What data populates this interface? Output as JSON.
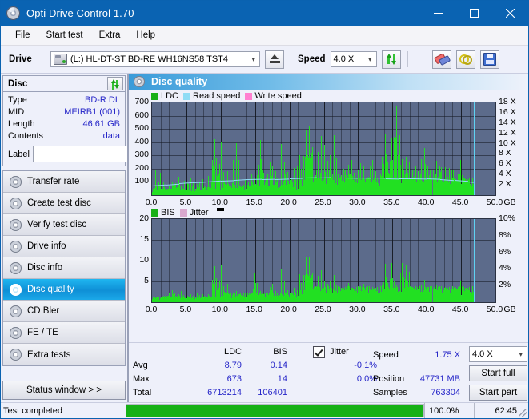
{
  "window": {
    "title": "Opti Drive Control 1.70",
    "icon": "disc-icon",
    "buttons": {
      "minimize": "–",
      "maximize": "□",
      "close": "✕"
    }
  },
  "menu": {
    "items": [
      "File",
      "Start test",
      "Extra",
      "Help"
    ]
  },
  "toolbar": {
    "drive_label": "Drive",
    "drive_value": "(L:)  HL-DT-ST BD-RE  WH16NS58 TST4",
    "eject_icon": "eject-icon",
    "speed_label": "Speed",
    "speed_value": "4.0 X",
    "refresh_icon": "refresh-icon",
    "eraser_icon": "eraser-icon",
    "chain_icon": "chain-icon",
    "save_icon": "floppy-save-icon"
  },
  "disc_panel": {
    "title": "Disc",
    "refresh_icon": "refresh-icon",
    "rows": [
      {
        "key": "Type",
        "value": "BD-R DL"
      },
      {
        "key": "MID",
        "value": "MEIRB1 (001)"
      },
      {
        "key": "Length",
        "value": "46.61 GB"
      },
      {
        "key": "Contents",
        "value": "data"
      }
    ],
    "label_key": "Label",
    "label_value": "",
    "label_placeholder": "",
    "label_button_icon": "cd-disc-icon"
  },
  "sidebar": {
    "items": [
      {
        "label": "Transfer rate",
        "icon": "disc-icon",
        "active": false
      },
      {
        "label": "Create test disc",
        "icon": "disc-icon",
        "active": false
      },
      {
        "label": "Verify test disc",
        "icon": "disc-icon",
        "active": false
      },
      {
        "label": "Drive info",
        "icon": "disc-icon",
        "active": false
      },
      {
        "label": "Disc info",
        "icon": "disc-icon",
        "active": false
      },
      {
        "label": "Disc quality",
        "icon": "disc-icon",
        "active": true
      },
      {
        "label": "CD Bler",
        "icon": "disc-icon",
        "active": false
      },
      {
        "label": "FE / TE",
        "icon": "disc-icon",
        "active": false
      },
      {
        "label": "Extra tests",
        "icon": "disc-icon",
        "active": false
      }
    ],
    "status_window_button": "Status window > >"
  },
  "content": {
    "header_title": "Disc quality",
    "header_icon": "disc-icon"
  },
  "stats": {
    "col_ldc": "LDC",
    "col_bis": "BIS",
    "row_avg": "Avg",
    "row_max": "Max",
    "row_total": "Total",
    "ldc_avg": "8.79",
    "ldc_max": "673",
    "ldc_total": "6713214",
    "bis_avg": "0.14",
    "bis_max": "14",
    "bis_total": "106401",
    "jitter_label": "Jitter",
    "jitter_checked": true,
    "jitter_avg": "-0.1%",
    "jitter_max": "0.0%",
    "speed_label": "Speed",
    "speed_value": "1.75 X",
    "position_label": "Position",
    "position_value": "47731 MB",
    "samples_label": "Samples",
    "samples_value": "763304",
    "speed_select": "4.0 X",
    "start_full_button": "Start full",
    "start_part_button": "Start part"
  },
  "statusbar": {
    "message": "Test completed",
    "progress_percent": "100.0%",
    "progress_value": 100,
    "elapsed": "62:45"
  },
  "colors": {
    "titlebar": "#0a63b2",
    "accent": "#0f8fd6",
    "plot_bg": "#5c6b8b",
    "ldc_green": "#22e022",
    "read_speed": "#8fdcf5",
    "write_speed": "#ff7fd0",
    "jitter_pink": "#d9a8cf",
    "value_blue": "#2626c8",
    "progress_green": "#16b016"
  },
  "chart_data": [
    {
      "type": "bar",
      "title": "Disc quality - LDC",
      "xlabel": "GB",
      "ylabel": "LDC",
      "xlim": [
        0,
        50
      ],
      "ylim": [
        0,
        700
      ],
      "xticks": [
        "0.0",
        "5.0",
        "10.0",
        "15.0",
        "20.0",
        "25.0",
        "30.0",
        "35.0",
        "40.0",
        "45.0",
        "50.0"
      ],
      "yticks": [
        100,
        200,
        300,
        400,
        500,
        600,
        700
      ],
      "y2label": "X",
      "y2lim": [
        0,
        18
      ],
      "y2ticks": [
        "2 X",
        "4 X",
        "6 X",
        "8 X",
        "10 X",
        "12 X",
        "14 X",
        "16 X",
        "18 X"
      ],
      "grid": true,
      "legend": [
        {
          "name": "LDC",
          "color": "#22e022"
        },
        {
          "name": "Read speed",
          "color": "#8fdcf5"
        },
        {
          "name": "Write speed",
          "color": "#ff7fd0"
        }
      ],
      "series": [
        {
          "name": "LDC",
          "color": "#22e022",
          "x": [
            0.3,
            0.8,
            1.2,
            1.6,
            2.0,
            2.4,
            2.9,
            3.3,
            3.8,
            4.2,
            4.7,
            5.1,
            5.6,
            6.0,
            6.5,
            6.9,
            7.3,
            7.8,
            8.2,
            8.7,
            9.1,
            9.6,
            10.0,
            10.4,
            10.9,
            11.3,
            11.8,
            12.2,
            12.6,
            13.1,
            13.5,
            14.0,
            14.4,
            14.9,
            15.3,
            15.7,
            16.2,
            16.6,
            17.1,
            17.5,
            18.0,
            18.4,
            18.8,
            19.3,
            19.7,
            20.2,
            20.6,
            21.1,
            21.5,
            21.9,
            22.4,
            22.8,
            23.3,
            23.7,
            24.1,
            24.6,
            25.0,
            25.5,
            25.9,
            26.4,
            26.8,
            27.2,
            27.7,
            28.1,
            28.6,
            29.0,
            29.5,
            29.9,
            30.3,
            30.8,
            31.2,
            31.7,
            32.1,
            32.5,
            33.0,
            33.4,
            33.9,
            34.3,
            34.8,
            35.2,
            35.6,
            36.1,
            36.5,
            37.0,
            37.4,
            37.9,
            38.3,
            38.7,
            39.2,
            39.6,
            40.1,
            40.5,
            40.9,
            41.4,
            41.8,
            42.3,
            42.7,
            43.2,
            43.6,
            44.0,
            44.5,
            44.9,
            45.4,
            45.8,
            46.2,
            46.6
          ],
          "y": [
            55,
            290,
            120,
            105,
            80,
            70,
            95,
            85,
            140,
            75,
            110,
            90,
            130,
            100,
            85,
            95,
            120,
            110,
            145,
            100,
            425,
            130,
            405,
            160,
            180,
            150,
            140,
            395,
            120,
            190,
            115,
            95,
            160,
            130,
            150,
            415,
            170,
            135,
            250,
            220,
            180,
            200,
            385,
            165,
            175,
            190,
            205,
            215,
            300,
            175,
            495,
            520,
            310,
            545,
            285,
            445,
            380,
            260,
            300,
            455,
            255,
            215,
            300,
            195,
            230,
            265,
            175,
            190,
            240,
            225,
            300,
            215,
            265,
            180,
            215,
            290,
            460,
            250,
            435,
            440,
            675,
            230,
            405,
            290,
            255,
            195,
            215,
            180,
            270,
            355,
            225,
            195,
            185,
            260,
            215,
            325,
            175,
            205,
            195,
            290,
            165,
            265,
            135,
            175,
            110,
            90
          ]
        },
        {
          "name": "Read speed",
          "color": "#8fdcf5",
          "x": [
            0,
            2,
            4,
            6,
            8,
            10,
            12,
            14,
            16,
            18,
            20,
            22,
            24,
            26,
            28,
            30,
            32,
            34,
            36,
            38,
            40,
            42,
            44,
            46,
            46.8
          ],
          "y": [
            72,
            80,
            88,
            95,
            100,
            108,
            112,
            118,
            120,
            122,
            126,
            130,
            132,
            134,
            134,
            132,
            130,
            128,
            126,
            126,
            124,
            120,
            112,
            104,
            100
          ]
        }
      ],
      "stats": {
        "avg": 8.79,
        "max": 673,
        "total": 6713214
      }
    },
    {
      "type": "bar",
      "title": "Disc quality - BIS",
      "xlabel": "GB",
      "ylabel": "BIS",
      "xlim": [
        0,
        50
      ],
      "ylim": [
        0,
        20
      ],
      "xticks": [
        "0.0",
        "5.0",
        "10.0",
        "15.0",
        "20.0",
        "25.0",
        "30.0",
        "35.0",
        "40.0",
        "45.0",
        "50.0"
      ],
      "yticks": [
        5,
        10,
        15,
        20
      ],
      "y2label": "%",
      "y2lim": [
        0,
        10
      ],
      "y2ticks": [
        "2%",
        "4%",
        "6%",
        "8%",
        "10%"
      ],
      "grid": true,
      "legend": [
        {
          "name": "BIS",
          "color": "#22e022"
        },
        {
          "name": "Jitter",
          "color": "#d9a8cf"
        }
      ],
      "series": [
        {
          "name": "BIS",
          "color": "#22e022",
          "x": [
            0.3,
            0.8,
            1.2,
            1.6,
            2.0,
            2.4,
            2.9,
            3.3,
            3.8,
            4.2,
            4.7,
            5.1,
            5.6,
            6.0,
            6.5,
            6.9,
            7.3,
            7.8,
            8.2,
            8.7,
            9.1,
            9.6,
            10.0,
            10.4,
            10.9,
            11.3,
            11.8,
            12.2,
            12.6,
            13.1,
            13.5,
            14.0,
            14.4,
            14.9,
            15.3,
            15.7,
            16.2,
            16.6,
            17.1,
            17.5,
            18.0,
            18.4,
            18.8,
            19.3,
            19.7,
            20.2,
            20.6,
            21.1,
            21.5,
            21.9,
            22.4,
            22.8,
            23.3,
            23.7,
            24.1,
            24.6,
            25.0,
            25.5,
            25.9,
            26.4,
            26.8,
            27.2,
            27.7,
            28.1,
            28.6,
            29.0,
            29.5,
            29.9,
            30.3,
            30.8,
            31.2,
            31.7,
            32.1,
            32.5,
            33.0,
            33.4,
            33.9,
            34.3,
            34.8,
            35.2,
            35.6,
            36.1,
            36.5,
            37.0,
            37.4,
            37.9,
            38.3,
            38.7,
            39.2,
            39.6,
            40.1,
            40.5,
            40.9,
            41.4,
            41.8,
            42.3,
            42.7,
            43.2,
            43.6,
            44.0,
            44.5,
            44.9,
            45.4,
            45.8,
            46.2,
            46.6
          ],
          "y": [
            0.6,
            1.0,
            0.8,
            1.0,
            2.6,
            2.2,
            2.8,
            2.4,
            2.0,
            2.6,
            1.4,
            1.6,
            2.0,
            1.6,
            2.2,
            1.8,
            2.0,
            2.4,
            2.0,
            2.6,
            8.6,
            2.4,
            9.0,
            3.2,
            4.4,
            2.6,
            2.2,
            2.6,
            2.0,
            2.2,
            2.0,
            1.8,
            2.4,
            7.0,
            2.2,
            2.6,
            2.0,
            2.2,
            3.6,
            4.4,
            2.6,
            3.0,
            8.0,
            2.4,
            2.8,
            3.0,
            3.4,
            2.8,
            6.8,
            4.4,
            11.0,
            10.8,
            5.6,
            10.6,
            4.6,
            7.6,
            5.2,
            4.4,
            5.0,
            6.6,
            4.0,
            3.6,
            4.4,
            3.2,
            4.6,
            3.4,
            3.0,
            3.2,
            3.8,
            4.4,
            3.4,
            3.0,
            3.6,
            2.8,
            3.4,
            4.0,
            9.2,
            4.6,
            9.4,
            5.2,
            4.0,
            3.4,
            14.0,
            9.0,
            7.4,
            3.6,
            3.8,
            3.2,
            4.2,
            5.4,
            3.6,
            3.2,
            3.0,
            4.0,
            3.4,
            5.6,
            3.0,
            3.6,
            3.2,
            4.6,
            3.0,
            5.0,
            2.6,
            3.0,
            2.2,
            1.8
          ]
        }
      ],
      "stats": {
        "avg": 0.14,
        "max": 14,
        "total": 106401
      }
    }
  ]
}
